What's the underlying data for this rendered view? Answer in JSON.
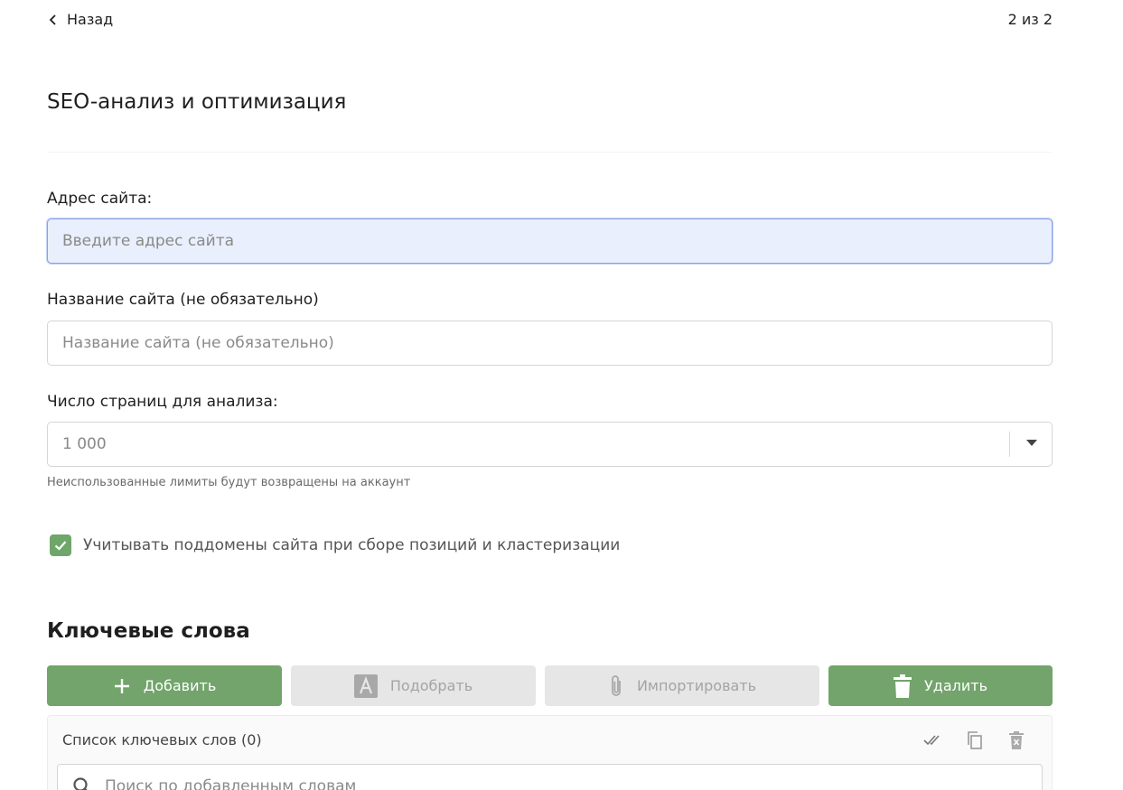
{
  "header": {
    "back_label": "Назад",
    "pager": "2 из 2"
  },
  "page_title": "SEO-анализ и оптимизация",
  "form": {
    "site_address": {
      "label": "Адрес сайта:",
      "placeholder": "Введите адрес сайта",
      "value": ""
    },
    "site_name": {
      "label": "Название сайта (не обязательно)",
      "placeholder": "Название сайта (не обязательно)",
      "value": ""
    },
    "pages_count": {
      "label": "Число страниц для анализа:",
      "selected": "1 000",
      "hint": "Неиспользованные лимиты будут возвращены на аккаунт"
    },
    "subdomains": {
      "checked": true,
      "label": "Учитывать поддомены сайта при сборе позиций и кластеризации"
    }
  },
  "keywords": {
    "title": "Ключевые слова",
    "buttons": {
      "add": "Добавить",
      "pick": "Подобрать",
      "import": "Импортировать",
      "delete": "Удалить"
    },
    "list_title": "Список ключевых слов (0)",
    "search_placeholder": "Поиск по добавленным словам",
    "icons": [
      "double-check-icon",
      "copy-icon",
      "trash-icon"
    ]
  },
  "colors": {
    "accent_green": "#72a46b",
    "focus_bg": "#e9effc",
    "disabled_bg": "#e6e6e6"
  }
}
